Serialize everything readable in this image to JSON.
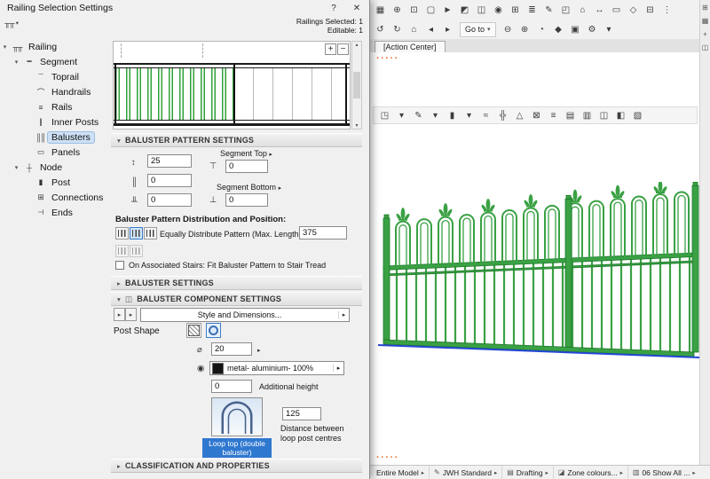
{
  "colors": {
    "green": "#3aa144",
    "green_dark": "#1f7a2b",
    "accent_blue": "#2f78d0",
    "accent_orange": "#e8742c",
    "selection_line_blue": "#2547d6"
  },
  "dialog": {
    "title": "Railing Selection Settings",
    "help_label": "?",
    "close_label": "✕",
    "favorites_glyph": "╥╥",
    "favorites_arrow": "▾",
    "info_line1": "Railings Selected: 1",
    "info_line2": "Editable: 1",
    "misc": {
      "arrow_right": "▸",
      "arrow_down": "▾"
    },
    "tree": {
      "items": [
        {
          "name": "tree-item-railing",
          "label": "Railing",
          "glyph": "╥╥",
          "arrow": "▾",
          "level": 0,
          "selected": false
        },
        {
          "name": "tree-item-segment",
          "label": "Segment",
          "glyph": "━",
          "arrow": "▾",
          "level": 1,
          "selected": false
        },
        {
          "name": "tree-item-toprail",
          "label": "Toprail",
          "glyph": "‾‾",
          "arrow": "",
          "level": 2,
          "selected": false
        },
        {
          "name": "tree-item-handrails",
          "label": "Handrails",
          "glyph": "⌒",
          "arrow": "",
          "level": 2,
          "selected": false
        },
        {
          "name": "tree-item-rails",
          "label": "Rails",
          "glyph": "≡",
          "arrow": "",
          "level": 2,
          "selected": false
        },
        {
          "name": "tree-item-inner-posts",
          "label": "Inner Posts",
          "glyph": "∥",
          "arrow": "",
          "level": 2,
          "selected": false
        },
        {
          "name": "tree-item-balusters",
          "label": "Balusters",
          "glyph": "║║",
          "arrow": "",
          "level": 2,
          "selected": true
        },
        {
          "name": "tree-item-panels",
          "label": "Panels",
          "glyph": "▭",
          "arrow": "",
          "level": 2,
          "selected": false
        },
        {
          "name": "tree-item-node",
          "label": "Node",
          "glyph": "┼",
          "arrow": "▾",
          "level": 1,
          "selected": false
        },
        {
          "name": "tree-item-post",
          "label": "Post",
          "glyph": "▮",
          "arrow": "",
          "level": 2,
          "selected": false
        },
        {
          "name": "tree-item-connections",
          "label": "Connections",
          "glyph": "⊞",
          "arrow": "",
          "level": 2,
          "selected": false
        },
        {
          "name": "tree-item-ends",
          "label": "Ends",
          "glyph": "⊣",
          "arrow": "",
          "level": 2,
          "selected": false
        }
      ]
    },
    "preview": {
      "zoom_in": "+",
      "zoom_out": "−",
      "scroll_up": "▴",
      "scroll_down": "▾"
    },
    "sections": {
      "pattern_title": "BALUSTER PATTERN SETTINGS",
      "pattern_arrow": "▾",
      "baluster_title": "BALUSTER SETTINGS",
      "baluster_arrow": "▸",
      "component_title": "BALUSTER COMPONENT SETTINGS",
      "component_arrow": "▾",
      "component_icon": "◫",
      "classification_title": "CLASSIFICATION AND PROPERTIES",
      "classification_arrow": "▸"
    },
    "pattern": {
      "height_icon": "↕",
      "height_value": "25",
      "offset1_icon": "║",
      "offset1_value": "0",
      "offset2_icon": "╨",
      "offset2_value": "0",
      "segment_top_label": "Segment Top",
      "segment_top_icon": "⊤",
      "segment_top_value": "0",
      "segment_bottom_label": "Segment Bottom",
      "segment_bottom_icon": "⊥",
      "segment_bottom_value": "0",
      "distribution_label": "Baluster Pattern Distribution and Position:",
      "equally_label": "Equally Distribute Pattern (Max. Length):",
      "equally_value": "375",
      "stairs_label": "On Associated Stairs: Fit Baluster Pattern to Stair Tread"
    },
    "component": {
      "style_dropdown_label": "Style and Dimensions...",
      "post_shape_label": "Post Shape",
      "diameter_glyph": "⌀",
      "diameter_value": "20",
      "material_glyph": "◉",
      "material_value": "metal- aluminium- 100%",
      "additional_height_value": "0",
      "additional_height_label": "Additional height",
      "thumb_label": "Loop top (double baluster)",
      "distance_value": "125",
      "distance_label": "Distance between loop post centres"
    }
  },
  "main": {
    "tab_label": "[Action Center]",
    "goto_label": "Go to",
    "selection_dots": "·····",
    "toolbar1": {
      "icons": [
        {
          "name": "model-views-icon",
          "glyph": "▦"
        },
        {
          "name": "zoom-icon",
          "glyph": "⊕"
        },
        {
          "name": "fit-in-window-icon",
          "glyph": "⊡"
        },
        {
          "name": "marquee-icon",
          "glyph": "▢"
        },
        {
          "name": "arrow-tool-icon",
          "glyph": "►"
        },
        {
          "name": "section-icon",
          "glyph": "◩"
        },
        {
          "name": "elevation-icon",
          "glyph": "◫"
        },
        {
          "name": "camera-icon",
          "glyph": "◉"
        },
        {
          "name": "grid-snap-icon",
          "glyph": "⊞"
        },
        {
          "name": "layers-icon",
          "glyph": "≣"
        },
        {
          "name": "pen-icon",
          "glyph": "✎"
        },
        {
          "name": "model-view-options-icon",
          "glyph": "◰"
        },
        {
          "name": "renovation-filter-icon",
          "glyph": "⌂"
        },
        {
          "name": "dimension-icon",
          "glyph": "↔"
        },
        {
          "name": "label-icon",
          "glyph": "▭"
        },
        {
          "name": "3d-style-icon",
          "glyph": "◇"
        },
        {
          "name": "publisher-icon",
          "glyph": "⊟"
        },
        {
          "name": "more-options-icon",
          "glyph": "⋮"
        }
      ]
    },
    "toolbar2_left": {
      "icons": [
        {
          "name": "undo-icon",
          "glyph": "↺"
        },
        {
          "name": "redo-icon",
          "glyph": "↻"
        },
        {
          "name": "home-view-icon",
          "glyph": "⌂"
        },
        {
          "name": "previous-view-icon",
          "glyph": "◂"
        },
        {
          "name": "next-view-icon",
          "glyph": "▸"
        }
      ]
    },
    "toolbar2_right": {
      "icons": [
        {
          "name": "zoom-out-icon",
          "glyph": "⊖"
        },
        {
          "name": "zoom-in-icon",
          "glyph": "⊕"
        },
        {
          "name": "orbit-icon",
          "glyph": "◔"
        },
        {
          "name": "walk-mode-icon",
          "glyph": "◆"
        },
        {
          "name": "layouts-icon",
          "glyph": "▣"
        },
        {
          "name": "settings-icon",
          "glyph": "⚙"
        },
        {
          "name": "quick-options-icon",
          "glyph": "▾"
        }
      ]
    },
    "toolbar3": {
      "icons": [
        {
          "name": "standard-view-icon",
          "glyph": "◳"
        },
        {
          "name": "view-dropdown-icon",
          "glyph": "▾"
        },
        {
          "name": "pen-set-icon",
          "glyph": "✎"
        },
        {
          "name": "pen-dropdown-icon",
          "glyph": "▾"
        },
        {
          "name": "column-tool-icon",
          "glyph": "▮"
        },
        {
          "name": "column-dropdown-icon",
          "glyph": "▾"
        },
        {
          "name": "wave-icon",
          "glyph": "≈"
        },
        {
          "name": "hatch-icon",
          "glyph": "╬"
        },
        {
          "name": "triangle-icon",
          "glyph": "△"
        },
        {
          "name": "trim-icon",
          "glyph": "⊠"
        },
        {
          "name": "align-icon",
          "glyph": "≡"
        },
        {
          "name": "sheet-icon",
          "glyph": "▤"
        },
        {
          "name": "detail-icon",
          "glyph": "▥"
        },
        {
          "name": "window-tool-icon",
          "glyph": "◫"
        },
        {
          "name": "shade-icon",
          "glyph": "◧"
        },
        {
          "name": "pattern-icon",
          "glyph": "▧"
        }
      ]
    },
    "right_strip": {
      "icons": [
        {
          "name": "panel-grid-icon",
          "glyph": "⊞"
        },
        {
          "name": "panel-views-icon",
          "glyph": "▦"
        },
        {
          "name": "panel-add-icon",
          "glyph": "+"
        },
        {
          "name": "panel-split-icon",
          "glyph": "◫"
        }
      ]
    },
    "statusbar": {
      "arrow": "▸",
      "items": [
        {
          "name": "status-entire-model",
          "glyph": "",
          "label": "Entire Model"
        },
        {
          "name": "status-pen-set",
          "glyph": "✎",
          "label": "JWH Standard"
        },
        {
          "name": "status-layer-combination",
          "glyph": "▤",
          "label": "Drafting"
        },
        {
          "name": "status-model-view-options",
          "glyph": "◪",
          "label": "Zone colours..."
        },
        {
          "name": "status-layout-book",
          "glyph": "▥",
          "label": "06 Show All ..."
        }
      ]
    }
  }
}
